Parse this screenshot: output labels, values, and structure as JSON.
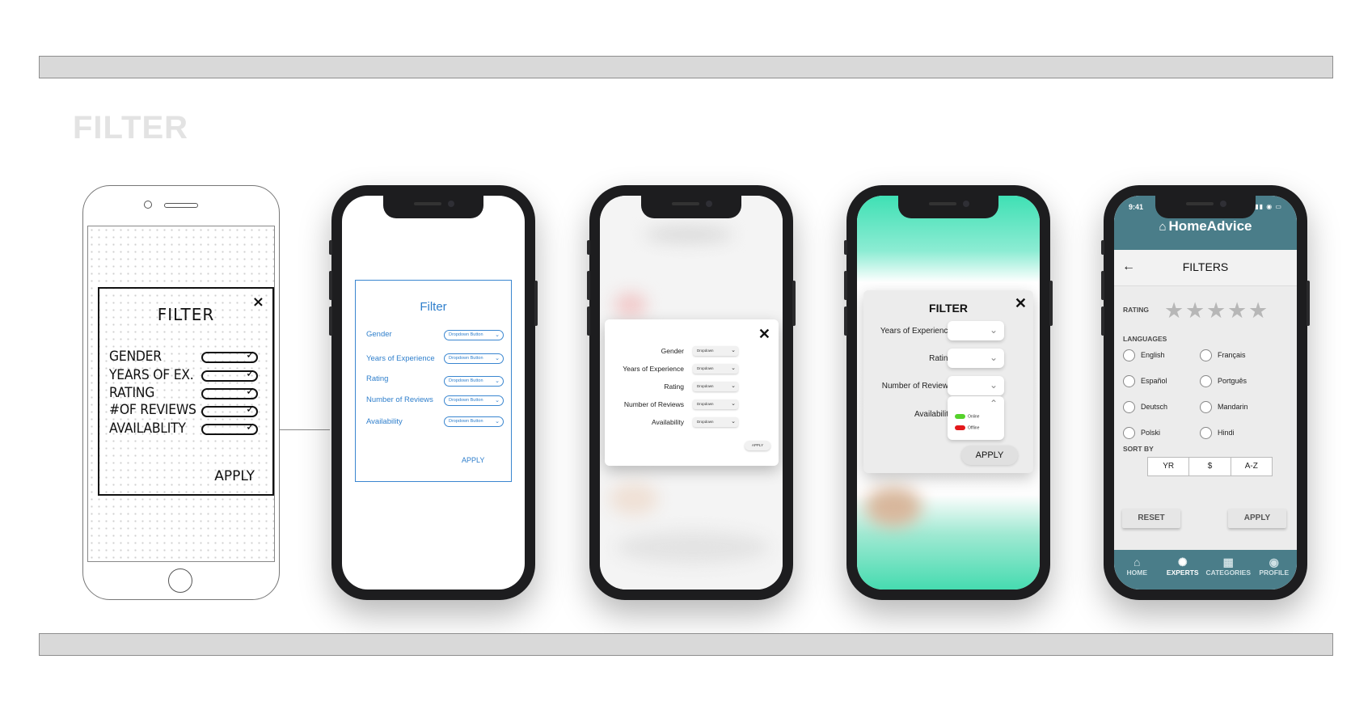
{
  "page_title": "FILTER",
  "sketch": {
    "title": "FILTER",
    "close": "×",
    "rows": [
      "GENDER",
      "YEARS OF EX.",
      "RATING",
      "#OF REVIEWS",
      "AVAILABLITY"
    ],
    "apply": "APPLY"
  },
  "wireframe": {
    "title": "Filter",
    "rows": [
      {
        "label": "Gender",
        "dropdown": "Dropdown Button"
      },
      {
        "label": "Years of Experience",
        "dropdown": "Dropdown Button"
      },
      {
        "label": "Rating",
        "dropdown": "Dropdown Button"
      },
      {
        "label": "Number of Reviews",
        "dropdown": "Dropdown Button"
      },
      {
        "label": "Availability",
        "dropdown": "Dropdown Button"
      }
    ],
    "apply": "APPLY"
  },
  "mockup1": {
    "close": "✕",
    "rows": [
      {
        "label": "Gender",
        "dropdown": "Dropdown"
      },
      {
        "label": "Years of Experience",
        "dropdown": "Dropdown"
      },
      {
        "label": "Rating",
        "dropdown": "Dropdown"
      },
      {
        "label": "Number of Reviews",
        "dropdown": "Dropdown"
      },
      {
        "label": "Availability",
        "dropdown": "Dropdown"
      }
    ],
    "apply": "APPLY"
  },
  "mockup2": {
    "title": "FILTER",
    "close": "✕",
    "rows": [
      "Years of Experience",
      "Rating",
      "Number of Reviews"
    ],
    "availability_label": "Availability",
    "options": [
      {
        "label": "Online",
        "color": "#55d22b"
      },
      {
        "label": "Offline",
        "color": "#e3181b"
      }
    ],
    "apply": "APPLY"
  },
  "final": {
    "time": "9:41",
    "status_icons": "▮▮▮ ◉ ▭",
    "brand": "HomeAdvice",
    "screen_title": "FILTERS",
    "rating_label": "RATING",
    "stars": [
      "★",
      "★",
      "★",
      "★",
      "★"
    ],
    "languages_label": "LANGUAGES",
    "languages": [
      "English",
      "Français",
      "Español",
      "Portguês",
      "Deutsch",
      "Mandarin",
      "Polski",
      "Hindi"
    ],
    "sort_label": "SORT BY",
    "sort_options": [
      "YR",
      "$",
      "A-Z"
    ],
    "reset": "RESET",
    "apply": "APPLY",
    "nav": [
      {
        "label": "HOME",
        "icon": "home-icon",
        "active": false
      },
      {
        "label": "EXPERTS",
        "icon": "lightbulb-icon",
        "active": true
      },
      {
        "label": "CATEGORIES",
        "icon": "grid-icon",
        "active": false
      },
      {
        "label": "PROFILE",
        "icon": "user-icon",
        "active": false
      }
    ],
    "accent": "#4a7d89"
  }
}
